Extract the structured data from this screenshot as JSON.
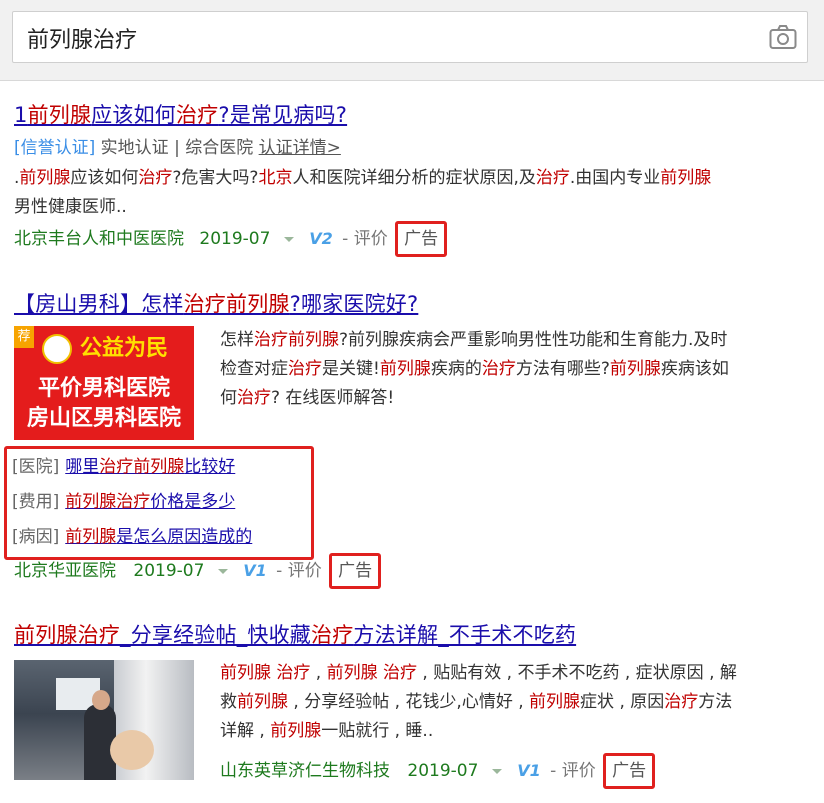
{
  "search": {
    "query": "前列腺治疗",
    "camera_icon": "camera-icon"
  },
  "results": [
    {
      "title": [
        {
          "t": "1",
          "hl": false
        },
        {
          "t": "前列腺",
          "hl": true
        },
        {
          "t": "应该如何",
          "hl": false
        },
        {
          "t": "治疗",
          "hl": true
        },
        {
          "t": "?是常见病吗?",
          "hl": false
        }
      ],
      "cert_tag": "[信誉认证]",
      "cert_text": "实地认证 | 综合医院",
      "cert_link": "认证详情>",
      "desc_lines": [
        [
          {
            "t": ".",
            "hl": false
          },
          {
            "t": "前列腺",
            "hl": true
          },
          {
            "t": "应该如何",
            "hl": false
          },
          {
            "t": "治疗",
            "hl": true
          },
          {
            "t": "?危害大吗?",
            "hl": false
          },
          {
            "t": "北京",
            "hl": true
          },
          {
            "t": "人和医院详细分析的症状原因,及",
            "hl": false
          },
          {
            "t": "治疗",
            "hl": true
          },
          {
            "t": ".由国内专业",
            "hl": false
          },
          {
            "t": "前列腺",
            "hl": true
          }
        ],
        [
          {
            "t": "男性健康医师..",
            "hl": false
          }
        ]
      ],
      "source": "北京丰台人和中医医院",
      "date": "2019-07",
      "v_level": "V2",
      "review": "- 评价",
      "ad_label": "广告"
    },
    {
      "title": [
        {
          "t": "【房山男科】怎样",
          "hl": false
        },
        {
          "t": "治疗前列腺",
          "hl": true
        },
        {
          "t": "?哪家医院好?",
          "hl": false
        }
      ],
      "image": {
        "tag": "荐",
        "slogan": "公益为民",
        "name_line1": "平价男科医院",
        "name_line2": "房山区男科医院"
      },
      "desc_lines": [
        [
          {
            "t": "怎样",
            "hl": false
          },
          {
            "t": "治疗前列腺",
            "hl": true
          },
          {
            "t": "?前列腺疾病会严重影响男性性功能和生育能力.及时",
            "hl": false
          }
        ],
        [
          {
            "t": "检查对症",
            "hl": false
          },
          {
            "t": "治疗",
            "hl": true
          },
          {
            "t": "是关键!",
            "hl": false
          },
          {
            "t": "前列腺",
            "hl": true
          },
          {
            "t": "疾病的",
            "hl": false
          },
          {
            "t": "治疗",
            "hl": true
          },
          {
            "t": "方法有哪些?",
            "hl": false
          },
          {
            "t": "前列腺",
            "hl": true
          },
          {
            "t": "疾病该如",
            "hl": false
          }
        ],
        [
          {
            "t": "何",
            "hl": false
          },
          {
            "t": "治疗",
            "hl": true
          },
          {
            "t": "? 在线医师解答!",
            "hl": false
          }
        ]
      ],
      "sublinks": [
        {
          "label": "[医院]",
          "parts": [
            {
              "t": "哪里",
              "hl": false
            },
            {
              "t": "治疗前列腺",
              "hl": true
            },
            {
              "t": "比较好",
              "hl": false
            }
          ]
        },
        {
          "label": "[费用]",
          "parts": [
            {
              "t": "前列腺治疗",
              "hl": true
            },
            {
              "t": "价格是多少",
              "hl": false
            }
          ]
        },
        {
          "label": "[病因]",
          "parts": [
            {
              "t": "前列腺",
              "hl": true
            },
            {
              "t": "是怎么原因造成的",
              "hl": false
            }
          ]
        }
      ],
      "source": "北京华亚医院",
      "date": "2019-07",
      "v_level": "V1",
      "review": "- 评价",
      "ad_label": "广告"
    },
    {
      "title": [
        {
          "t": "前列腺治疗",
          "hl": true
        },
        {
          "t": "_分享经验帖_快收藏",
          "hl": false
        },
        {
          "t": "治疗",
          "hl": true
        },
        {
          "t": "方法详解_不手术不吃药",
          "hl": false
        }
      ],
      "desc_lines": [
        [
          {
            "t": "前列腺 治疗",
            "hl": true
          },
          {
            "t": " , ",
            "hl": false
          },
          {
            "t": "前列腺 治疗",
            "hl": true
          },
          {
            "t": " , 贴贴有效 , 不手术不吃药 , 症状原因 , 解",
            "hl": false
          }
        ],
        [
          {
            "t": "救",
            "hl": false
          },
          {
            "t": "前列腺",
            "hl": true
          },
          {
            "t": " , 分享经验帖 , 花钱少,心情好 , ",
            "hl": false
          },
          {
            "t": "前列腺",
            "hl": true
          },
          {
            "t": "症状 , 原因",
            "hl": false
          },
          {
            "t": "治疗",
            "hl": true
          },
          {
            "t": "方法",
            "hl": false
          }
        ],
        [
          {
            "t": "详解 , ",
            "hl": false
          },
          {
            "t": "前列腺",
            "hl": true
          },
          {
            "t": "一贴就行 , 睡..",
            "hl": false
          }
        ]
      ],
      "source": "山东英草济仁生物科技",
      "date": "2019-07",
      "v_level": "V1",
      "review": "- 评价",
      "ad_label": "广告"
    }
  ]
}
